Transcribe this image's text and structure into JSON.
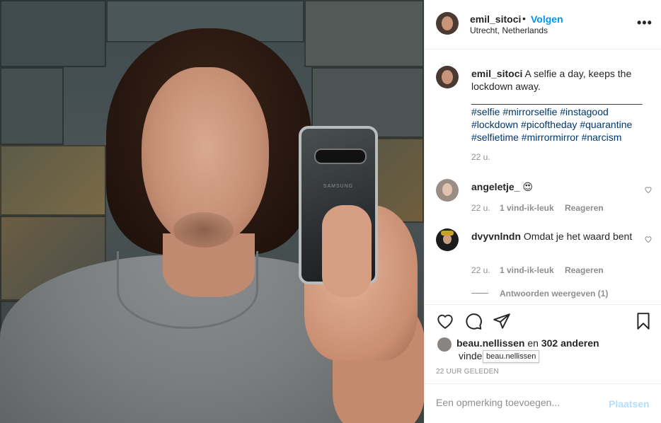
{
  "post": {
    "photo_alt_icon": "selfie-photo",
    "phone_brand": "SAMSUNG"
  },
  "header": {
    "username": "emil_sitoci",
    "separator": "•",
    "follow_label": "Volgen",
    "location": "Utrecht, Netherlands",
    "more_icon": "more-options-icon",
    "more_label": "•••"
  },
  "caption": {
    "username": "emil_sitoci",
    "text": "A selfie a day, keeps the lockdown away.",
    "rule": "_______________________________",
    "hashtags": "#selfie #mirrorselfie #instagood #lockdown #picoftheday #quarantine #selfietime #mirrormirror #narcism",
    "time": "22 u."
  },
  "comments": [
    {
      "username": "angeletje_",
      "text": "😍",
      "time": "22 u.",
      "likes": "1 vind-ik-leuk",
      "reply": "Reageren"
    },
    {
      "username": "dvyvnlndn",
      "text": "Omdat je het waard bent",
      "time": "22 u.",
      "likes": "1 vind-ik-leuk",
      "reply": "Reageren"
    }
  ],
  "view_replies": "Antwoorden weergeven (1)",
  "actions": {
    "like_icon": "heart-icon",
    "comment_icon": "comment-icon",
    "share_icon": "share-icon",
    "save_icon": "bookmark-icon"
  },
  "likes": {
    "liker": "beau.nellissen",
    "connector": "en",
    "others": "302 anderen",
    "verb_partial": "vinde",
    "tooltip": "beau.nellissen"
  },
  "posted": "22 UUR GELEDEN",
  "comment_box": {
    "placeholder": "Een opmerking toevoegen...",
    "post_label": "Plaatsen"
  },
  "colors": {
    "accent": "#0095f6",
    "hashtag": "#00376b",
    "muted": "#8e8e8e",
    "post_disabled": "#b2dffc"
  }
}
